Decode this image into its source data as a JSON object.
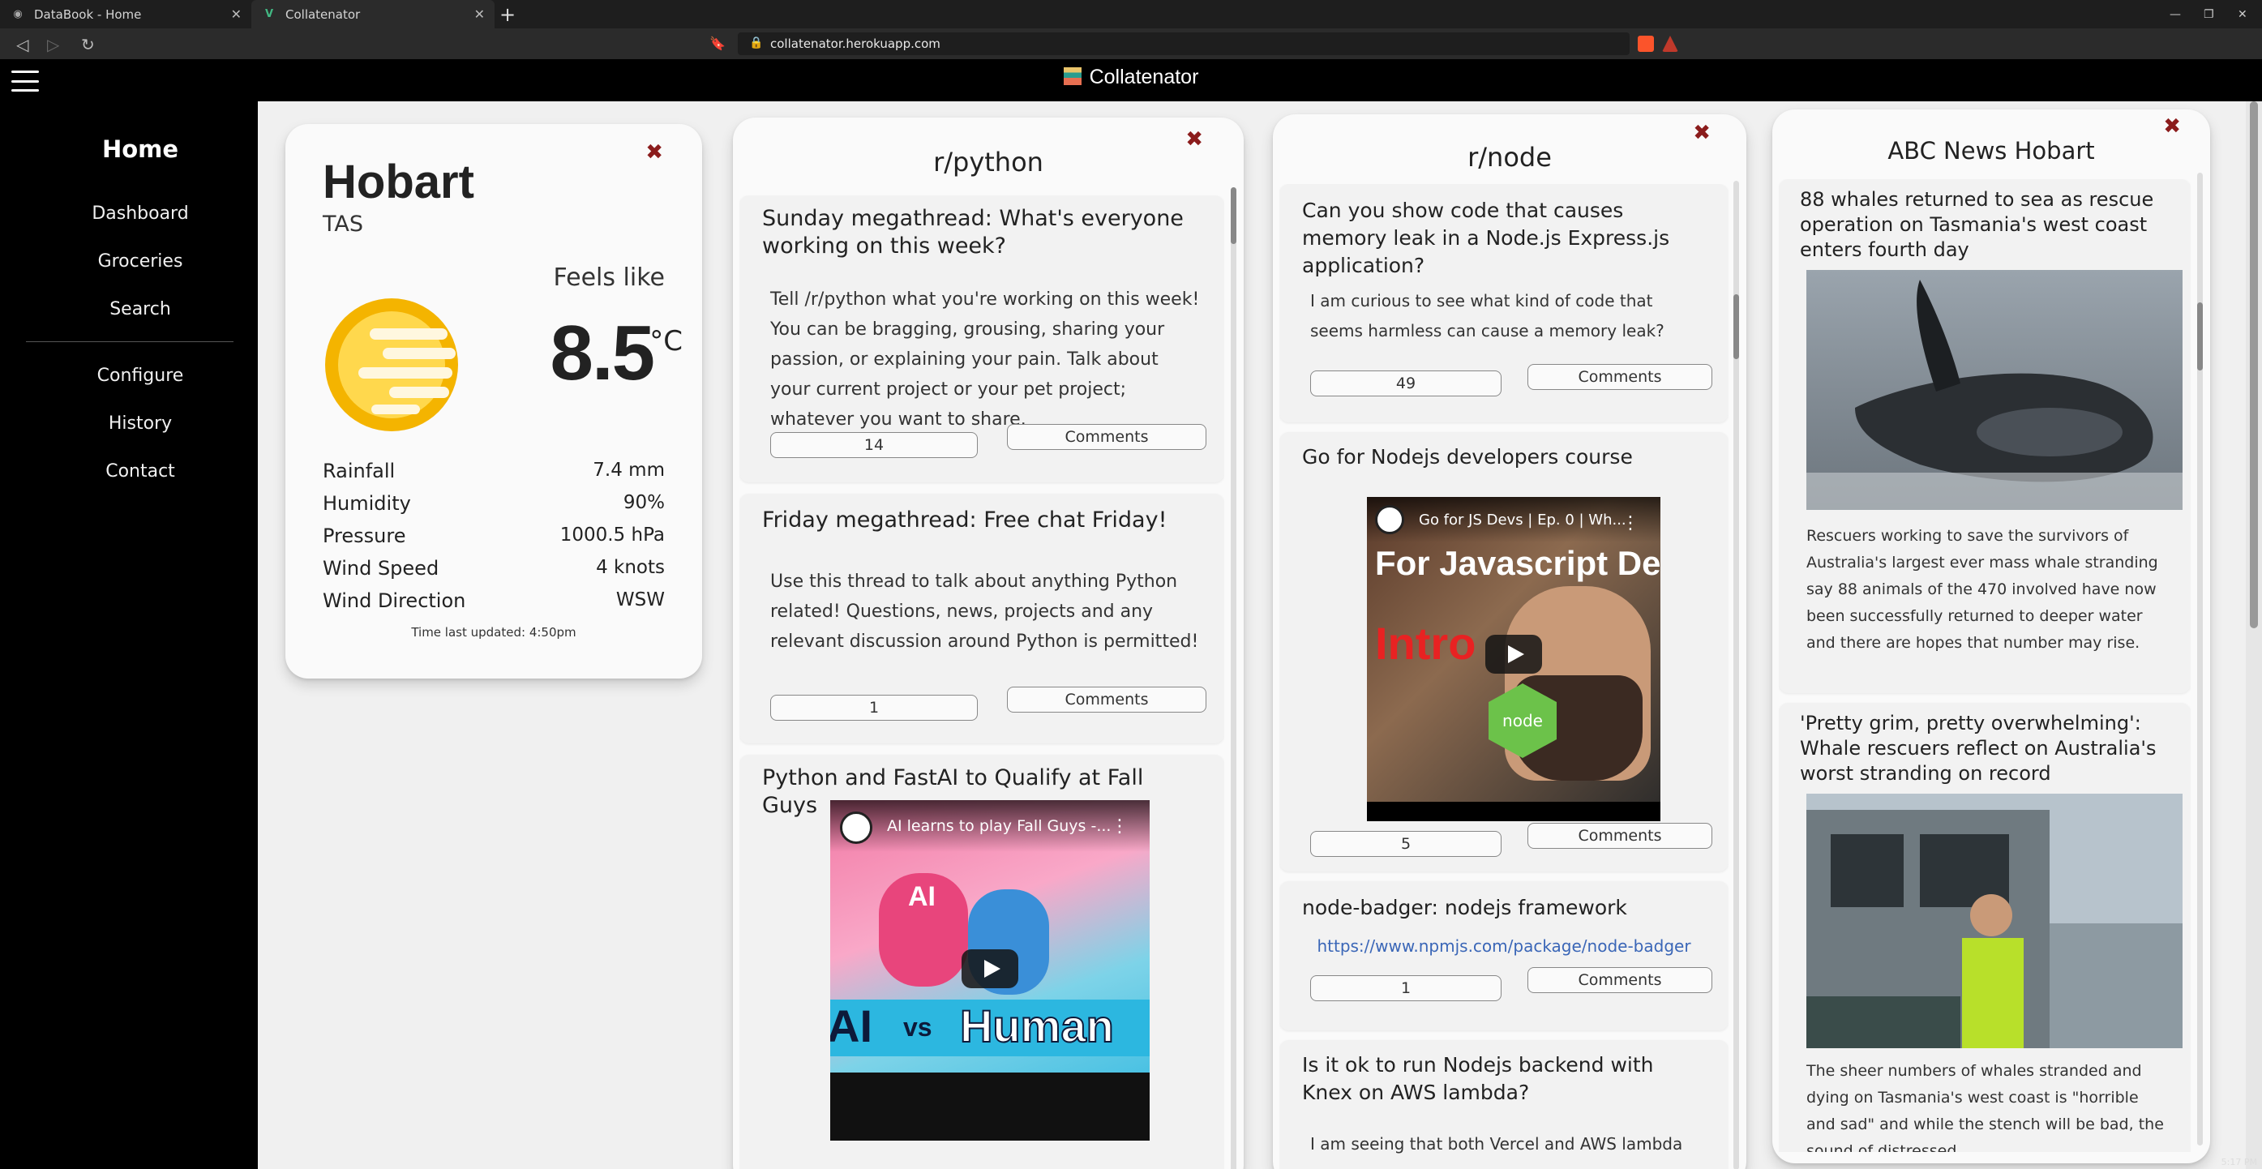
{
  "browser": {
    "tabs": [
      {
        "title": "DataBook - Home"
      },
      {
        "title": "Collatenator"
      }
    ],
    "url": "collatenator.herokuapp.com"
  },
  "app": {
    "title": "Collatenator"
  },
  "sidebar": {
    "home": "Home",
    "items": [
      {
        "label": "Dashboard"
      },
      {
        "label": "Groceries"
      },
      {
        "label": "Search"
      },
      {
        "label": "Configure"
      },
      {
        "label": "History"
      },
      {
        "label": "Contact"
      }
    ]
  },
  "weather": {
    "city": "Hobart",
    "state": "TAS",
    "feels_like_label": "Feels like",
    "temperature": "8.5",
    "unit": "°C",
    "icon": "sun-haze-icon",
    "rows": [
      {
        "label": "Rainfall",
        "value": "7.4 mm"
      },
      {
        "label": "Humidity",
        "value": "90%"
      },
      {
        "label": "Pressure",
        "value": "1000.5 hPa"
      },
      {
        "label": "Wind Speed",
        "value": "4 knots"
      },
      {
        "label": "Wind Direction",
        "value": "WSW"
      }
    ],
    "updated": "Time last updated: 4:50pm"
  },
  "python": {
    "title": "r/python",
    "posts": [
      {
        "title": "Sunday megathread: What's everyone working on this week?",
        "body": "Tell /r/python what you're working on this week! You can be bragging, grousing, sharing your passion, or explaining your pain. Talk about your current project or your pet project; whatever you want to share.",
        "score": "14",
        "comments": "Comments"
      },
      {
        "title": "Friday megathread: Free chat Friday!",
        "body": "Use this thread to talk about anything Python related! Questions, news, projects and any relevant discussion around Python is permitted!",
        "score": "1",
        "comments": "Comments"
      },
      {
        "title": "Python and FastAI to Qualify at Fall Guys",
        "video_title": "AI learns to play Fall Guys -...",
        "video_text_left": "AI",
        "video_text_vs": "vs",
        "video_text_right": "Human",
        "video_badge": "AI"
      }
    ]
  },
  "node": {
    "title": "r/node",
    "posts": [
      {
        "title": "Can you show code that causes memory leak in a Node.js Express.js application?",
        "body": "I am curious to see what kind of code that seems harmless can cause a memory leak?",
        "score": "49",
        "comments": "Comments"
      },
      {
        "title": "Go for Nodejs developers course",
        "video_title": "Go for JS Devs | Ep. 0 | Wh...",
        "video_headline": "For Javascript De",
        "video_intro": "Intro",
        "video_badge": "node",
        "score": "5",
        "comments": "Comments"
      },
      {
        "title": "node-badger: nodejs framework",
        "link": "https://www.npmjs.com/package/node-badger",
        "score": "1",
        "comments": "Comments"
      },
      {
        "title": "Is it ok to run Nodejs backend with Knex on AWS lambda?",
        "body": "I am seeing that both Vercel and AWS lambda"
      }
    ]
  },
  "news": {
    "title": "ABC News Hobart",
    "items": [
      {
        "title": "88 whales returned to sea as rescue operation on Tasmania's west coast enters fourth day",
        "body": "Rescuers working to save the survivors of Australia's largest ever mass whale stranding say 88 animals of the 470 involved have now been successfully returned to deeper water and there are hopes that number may rise."
      },
      {
        "title": "'Pretty grim, pretty overwhelming': Whale rescuers reflect on Australia's worst stranding on record",
        "body": "The sheer numbers of whales stranded and dying on Tasmania's west coast is \"horrible and sad\" and while the stench will be bad, the sound of distressed"
      }
    ]
  },
  "taskbar": {
    "time": "5:17 PM"
  }
}
